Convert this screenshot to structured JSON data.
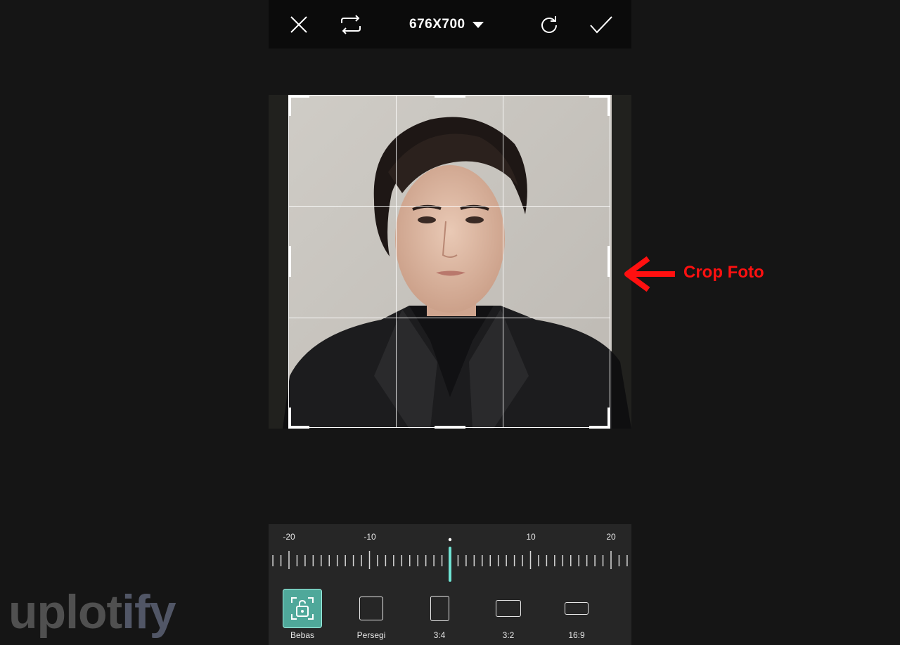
{
  "header": {
    "close_icon": "close-icon",
    "swap_icon": "swap-icon",
    "size_label": "676X700",
    "redo_icon": "redo-icon",
    "confirm_icon": "check-icon"
  },
  "annotation": {
    "label": "Crop Foto",
    "color": "#ff1010"
  },
  "rotation": {
    "scale_labels": [
      "-20",
      "-10",
      "10",
      "20"
    ],
    "value": 0,
    "accent": "#6fe3d3"
  },
  "ratios": [
    {
      "label": "Bebas",
      "active": true
    },
    {
      "label": "Persegi",
      "active": false
    },
    {
      "label": "3:4",
      "active": false
    },
    {
      "label": "3:2",
      "active": false
    },
    {
      "label": "16:9",
      "active": false
    }
  ],
  "watermark": {
    "part1": "uplot",
    "part2": "ify"
  }
}
